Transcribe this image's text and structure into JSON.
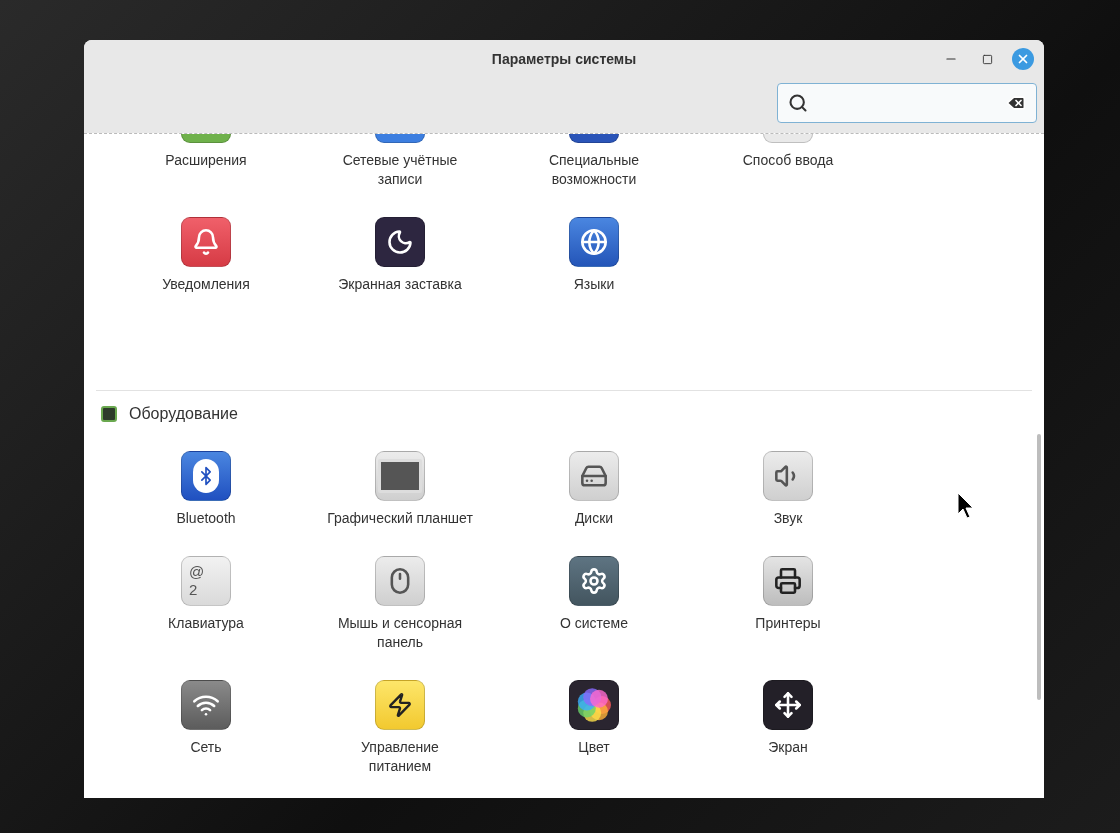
{
  "window": {
    "title": "Параметры системы"
  },
  "sections": [
    {
      "items": [
        {
          "label": "Расширения",
          "kind": "extensions",
          "cut": true
        },
        {
          "label": "Сетевые учётные записи",
          "kind": "accounts",
          "cut": true
        },
        {
          "label": "Специальные возможности",
          "kind": "accessibility",
          "cut": true
        },
        {
          "label": "Способ ввода",
          "kind": "input",
          "cut": true
        },
        {
          "label": "Уведомления",
          "kind": "notifications"
        },
        {
          "label": "Экранная заставка",
          "kind": "screensaver"
        },
        {
          "label": "Языки",
          "kind": "languages"
        }
      ]
    },
    {
      "title": "Оборудование",
      "items": [
        {
          "label": "Bluetooth",
          "kind": "bluetooth"
        },
        {
          "label": "Графический планшет",
          "kind": "tablet"
        },
        {
          "label": "Диски",
          "kind": "disks"
        },
        {
          "label": "Звук",
          "kind": "sound"
        },
        {
          "label": "Клавиатура",
          "kind": "keyboard",
          "glyphs": [
            "@",
            "2"
          ]
        },
        {
          "label": "Мышь и сенсорная панель",
          "kind": "mouse"
        },
        {
          "label": "О системе",
          "kind": "about"
        },
        {
          "label": "Принтеры",
          "kind": "printers"
        },
        {
          "label": "Сеть",
          "kind": "network"
        },
        {
          "label": "Управление\nпитанием",
          "kind": "power"
        },
        {
          "label": "Цвет",
          "kind": "color"
        },
        {
          "label": "Экран",
          "kind": "display"
        }
      ]
    }
  ]
}
